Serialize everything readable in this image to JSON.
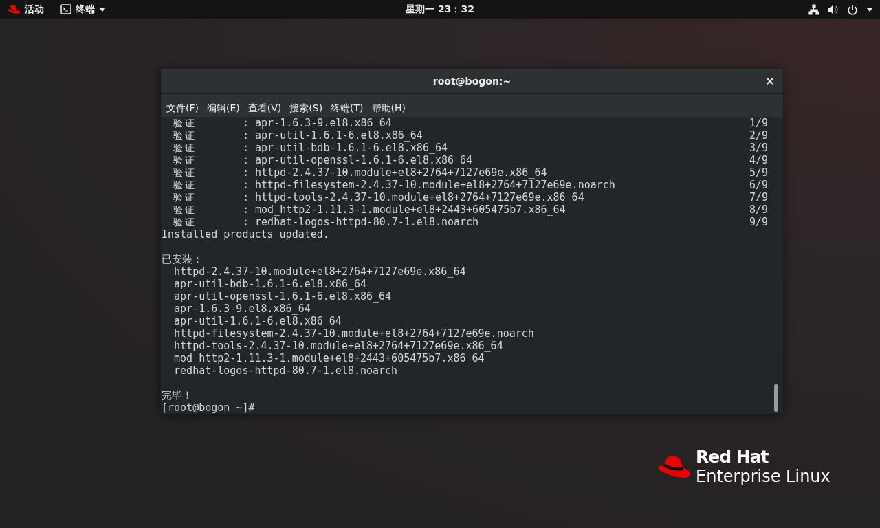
{
  "top_bar": {
    "activities": "活动",
    "app_menu": "终端",
    "clock": "星期一 23：32"
  },
  "terminal": {
    "title": "root@bogon:~",
    "menu": [
      "文件(F)",
      "编辑(E)",
      "查看(V)",
      "搜索(S)",
      "终端(T)",
      "帮助(H)"
    ],
    "lines": [
      {
        "kind": "verify",
        "label": "验证",
        "detail": ": apr-1.6.3-9.el8.x86_64",
        "count": "1/9"
      },
      {
        "kind": "verify",
        "label": "验证",
        "detail": ": apr-util-1.6.1-6.el8.x86_64",
        "count": "2/9"
      },
      {
        "kind": "verify",
        "label": "验证",
        "detail": ": apr-util-bdb-1.6.1-6.el8.x86_64",
        "count": "3/9"
      },
      {
        "kind": "verify",
        "label": "验证",
        "detail": ": apr-util-openssl-1.6.1-6.el8.x86_64",
        "count": "4/9"
      },
      {
        "kind": "verify",
        "label": "验证",
        "detail": ": httpd-2.4.37-10.module+el8+2764+7127e69e.x86_64",
        "count": "5/9"
      },
      {
        "kind": "verify",
        "label": "验证",
        "detail": ": httpd-filesystem-2.4.37-10.module+el8+2764+7127e69e.noarch",
        "count": "6/9"
      },
      {
        "kind": "verify",
        "label": "验证",
        "detail": ": httpd-tools-2.4.37-10.module+el8+2764+7127e69e.x86_64",
        "count": "7/9"
      },
      {
        "kind": "verify",
        "label": "验证",
        "detail": ": mod_http2-1.11.3-1.module+el8+2443+605475b7.x86_64",
        "count": "8/9"
      },
      {
        "kind": "verify",
        "label": "验证",
        "detail": ": redhat-logos-httpd-80.7-1.el8.noarch",
        "count": "9/9"
      },
      {
        "kind": "text",
        "text": "Installed products updated."
      },
      {
        "kind": "blank"
      },
      {
        "kind": "text",
        "text": "已安装："
      },
      {
        "kind": "item",
        "text": "httpd-2.4.37-10.module+el8+2764+7127e69e.x86_64"
      },
      {
        "kind": "item",
        "text": "apr-util-bdb-1.6.1-6.el8.x86_64"
      },
      {
        "kind": "item",
        "text": "apr-util-openssl-1.6.1-6.el8.x86_64"
      },
      {
        "kind": "item",
        "text": "apr-1.6.3-9.el8.x86_64"
      },
      {
        "kind": "item",
        "text": "apr-util-1.6.1-6.el8.x86_64"
      },
      {
        "kind": "item",
        "text": "httpd-filesystem-2.4.37-10.module+el8+2764+7127e69e.noarch"
      },
      {
        "kind": "item",
        "text": "httpd-tools-2.4.37-10.module+el8+2764+7127e69e.x86_64"
      },
      {
        "kind": "item",
        "text": "mod_http2-1.11.3-1.module+el8+2443+605475b7.x86_64"
      },
      {
        "kind": "item",
        "text": "redhat-logos-httpd-80.7-1.el8.noarch"
      },
      {
        "kind": "blank"
      },
      {
        "kind": "text",
        "text": "完毕！"
      },
      {
        "kind": "prompt",
        "text": "[root@bogon ~]#"
      }
    ]
  },
  "logo": {
    "brand": "Red Hat",
    "product": "Enterprise Linux"
  }
}
